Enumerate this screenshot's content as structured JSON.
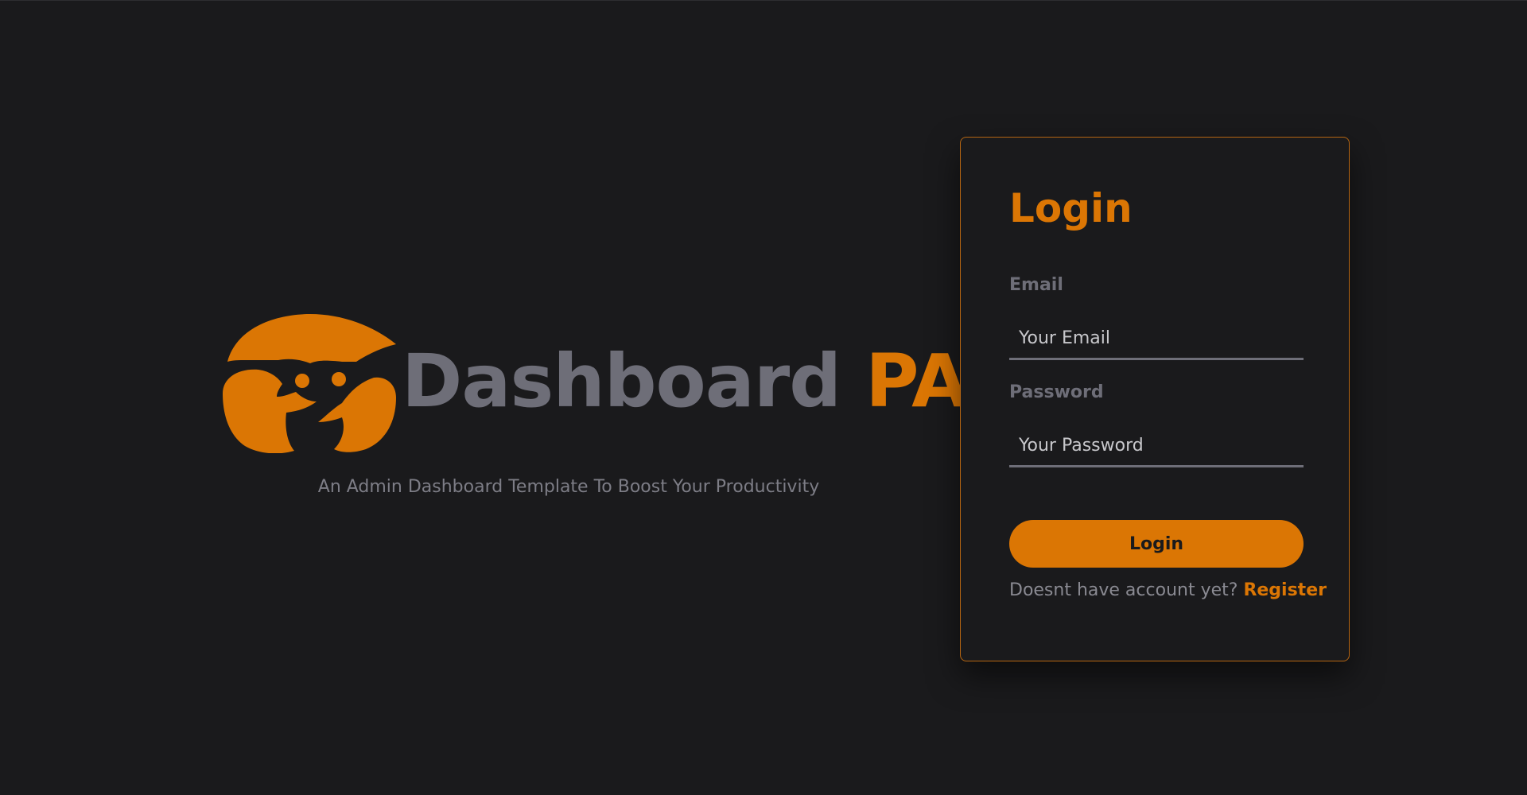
{
  "brand": {
    "name_part1": "Dashboard",
    "name_part2": "PAL",
    "tagline": "An Admin Dashboard Template To Boost Your Productivity",
    "logo_icon": "smiling-face-logo-icon"
  },
  "login_form": {
    "title": "Login",
    "email_label": "Email",
    "email_placeholder": "Your Email",
    "email_value": "",
    "password_label": "Password",
    "password_placeholder": "Your Password",
    "password_value": "",
    "submit_label": "Login",
    "register_prompt": "Doesnt have account yet?",
    "register_link": "Register"
  },
  "colors": {
    "background": "#1a1a1c",
    "accent": "#db7604",
    "muted_text": "#6e6e78",
    "card_border": "#b56512"
  }
}
